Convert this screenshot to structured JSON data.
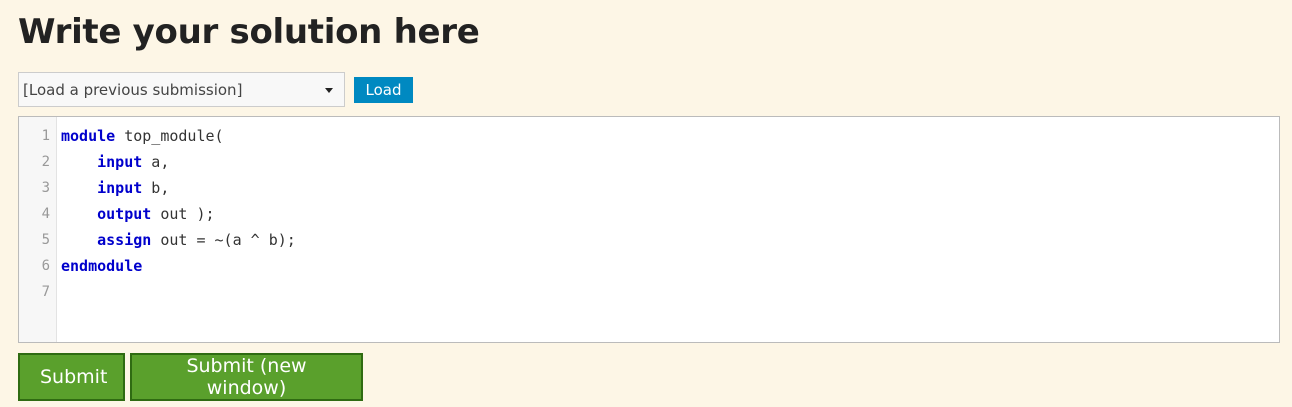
{
  "page": {
    "title": "Write your solution here"
  },
  "loader": {
    "select_value": "[Load a previous submission]",
    "load_label": "Load"
  },
  "editor": {
    "line_numbers": [
      "1",
      "2",
      "3",
      "4",
      "5",
      "6",
      "7"
    ],
    "lines": [
      [
        {
          "t": "module",
          "kw": true
        },
        {
          "t": " top_module(",
          "kw": false
        }
      ],
      [
        {
          "t": "    ",
          "kw": false
        },
        {
          "t": "input",
          "kw": true
        },
        {
          "t": " a,",
          "kw": false
        }
      ],
      [
        {
          "t": "    ",
          "kw": false
        },
        {
          "t": "input",
          "kw": true
        },
        {
          "t": " b,",
          "kw": false
        }
      ],
      [
        {
          "t": "    ",
          "kw": false
        },
        {
          "t": "output",
          "kw": true
        },
        {
          "t": " out );",
          "kw": false
        }
      ],
      [
        {
          "t": "    ",
          "kw": false
        },
        {
          "t": "assign",
          "kw": true
        },
        {
          "t": " out = ~(a ^ b);",
          "kw": false
        }
      ],
      [
        {
          "t": "endmodule",
          "kw": true
        }
      ],
      []
    ]
  },
  "actions": {
    "submit_label": "Submit",
    "submit_new_window_label": "Submit (new window)"
  },
  "colors": {
    "background": "#fdf6e6",
    "load_button": "#0089c1",
    "submit_button": "#5aa02c",
    "keyword": "#0000cc"
  }
}
